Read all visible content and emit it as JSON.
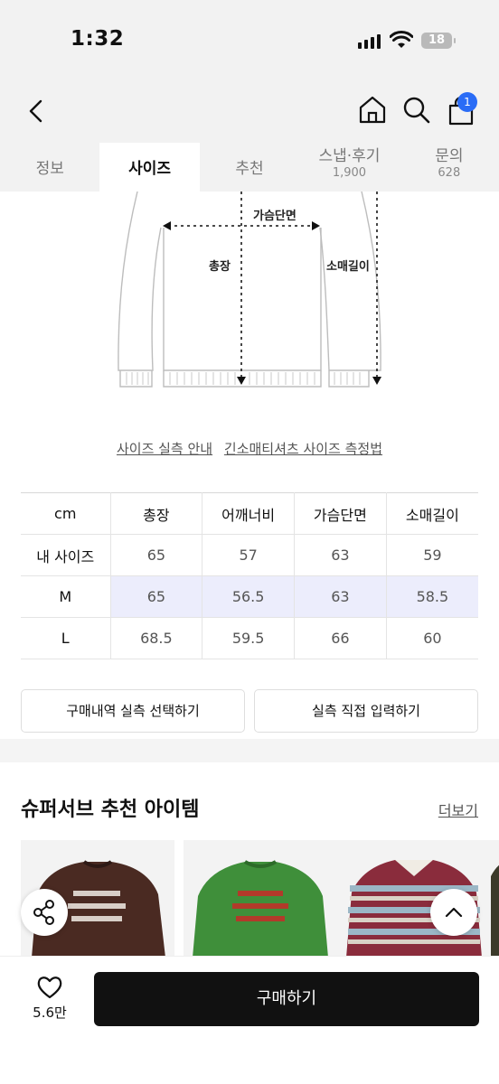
{
  "status_bar": {
    "time": "1:32",
    "battery": "18"
  },
  "nav": {
    "cart_count": "1"
  },
  "tabs": [
    {
      "label": "정보",
      "count": ""
    },
    {
      "label": "사이즈",
      "count": ""
    },
    {
      "label": "추천",
      "count": ""
    },
    {
      "label": "스냅·후기",
      "count": "1,900"
    },
    {
      "label": "문의",
      "count": "628"
    }
  ],
  "diagram": {
    "chest": "가슴단면",
    "length": "총장",
    "sleeve": "소매길이"
  },
  "guides": {
    "measure_guide": "사이즈 실측 안내",
    "method": "긴소매티셔츠 사이즈 측정법"
  },
  "size_table": {
    "header": [
      "cm",
      "총장",
      "어깨너비",
      "가슴단면",
      "소매길이"
    ],
    "rows": [
      [
        "내 사이즈",
        "65",
        "57",
        "63",
        "59"
      ],
      [
        "M",
        "65",
        "56.5",
        "63",
        "58.5"
      ],
      [
        "L",
        "68.5",
        "59.5",
        "66",
        "60"
      ]
    ]
  },
  "buttons": {
    "select_history": "구매내역 실측 선택하기",
    "direct_input": "실측 직접 입력하기"
  },
  "recommend": {
    "title": "슈퍼서브 추천 아이템",
    "more": "더보기",
    "products": [
      {
        "name": "brown knit sweater",
        "color": "#4a2a22"
      },
      {
        "name": "green knit sweater",
        "color": "#3f8f3a"
      },
      {
        "name": "striped polo knit",
        "color": "#8a2c3c"
      }
    ]
  },
  "bottom_bar": {
    "likes": "5.6만",
    "buy_label": "구매하기"
  }
}
